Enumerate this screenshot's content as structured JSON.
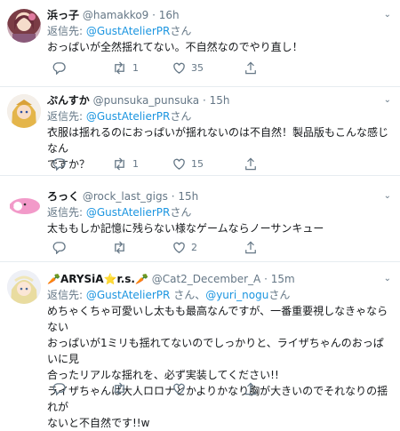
{
  "tweets": [
    {
      "name": "浜っ子",
      "handle": "@hamakko9",
      "time": "16h",
      "reply_prefix": "返信先: ",
      "reply_to": "@GustAtelierPR",
      "reply_suffix": "さん",
      "text": "おっぱいが全然揺れてない。不自然なのでやり直し！",
      "replies": "",
      "retweets": "1",
      "likes": "35"
    },
    {
      "name": "ぷんすか",
      "handle": "@punsuka_punsuka",
      "time": "15h",
      "reply_prefix": "返信先: ",
      "reply_to": "@GustAtelierPR",
      "reply_suffix": "さん",
      "text": "衣服は揺れるのにおっぱいが揺れないのは不自然！製品版もこんな感じなん\nですか？",
      "replies": "",
      "retweets": "1",
      "likes": "15"
    },
    {
      "name": "ろっく",
      "handle": "@rock_last_gigs",
      "time": "15h",
      "reply_prefix": "返信先: ",
      "reply_to": "@GustAtelierPR",
      "reply_suffix": "さん",
      "text": "太ももしか記憶に残らない様なゲームならノーサンキュー",
      "replies": "",
      "retweets": "",
      "likes": "2"
    },
    {
      "name": "🥕ARYSiA⭐r.s.🥕",
      "handle": "@Cat2_December_A",
      "time": "15m",
      "reply_prefix": "返信先: ",
      "reply_to": "@GustAtelierPR",
      "reply_mid": " さん、",
      "reply_to2": "@yuri_nogu",
      "reply_suffix": "さん",
      "text": "めちゃくちゃ可愛いし太もも最高なんですが、一番重要視しなきゃならない\nおっぱいが1ミリも揺れてないのでしっかりと、ライザちゃんのおっぱいに見\n合ったリアルな揺れを、必ず実装してください!!\nライザちゃんは大人ロロナとかよりかなり胸が大きいのでそれなりの揺れが\nないと不自然です!!w",
      "replies": "",
      "retweets": "",
      "likes": ""
    }
  ],
  "separator": "·",
  "icons": {
    "reply": "reply-icon",
    "retweet": "retweet-icon",
    "like": "heart-icon",
    "share": "share-icon",
    "chevron": "chevron-down-icon"
  }
}
